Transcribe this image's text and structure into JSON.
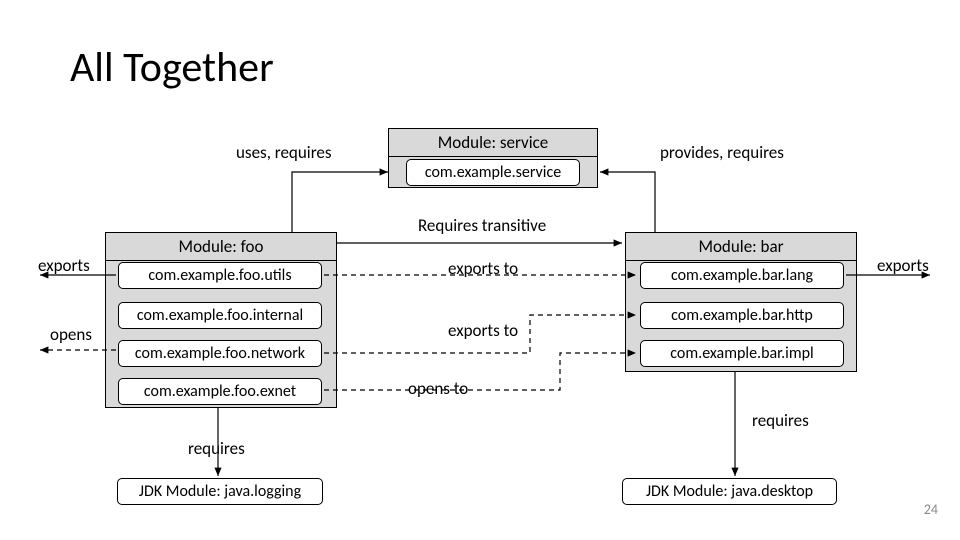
{
  "title": "All Together",
  "labels": {
    "uses_requires": "uses, requires",
    "provides_requires": "provides, requires",
    "requires_transitive": "Requires transitive",
    "exports_left": "exports",
    "exports_right": "exports",
    "exports_to_1": "exports to",
    "exports_to_2": "exports to",
    "opens": "opens",
    "opens_to": "opens to",
    "requires_foo": "requires",
    "requires_bar": "requires"
  },
  "service": {
    "title": "Module: service",
    "pkg": "com.example.service"
  },
  "foo": {
    "title": "Module: foo",
    "pkgs": [
      "com.example.foo.utils",
      "com.example.foo.internal",
      "com.example.foo.network",
      "com.example.foo.exnet"
    ]
  },
  "bar": {
    "title": "Module: bar",
    "pkgs": [
      "com.example.bar.lang",
      "com.example.bar.http",
      "com.example.bar.impl"
    ]
  },
  "jdk_logging": "JDK Module: java.logging",
  "jdk_desktop": "JDK Module: java.desktop",
  "slide_number": "24"
}
